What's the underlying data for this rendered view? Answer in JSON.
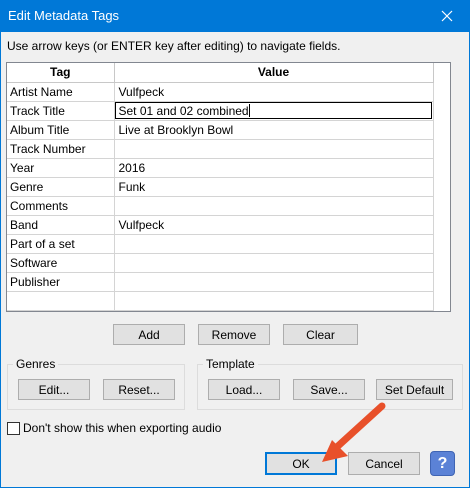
{
  "window": {
    "title": "Edit Metadata Tags",
    "close_glyph": "✕"
  },
  "instructions": "Use arrow keys (or ENTER key after editing) to navigate fields.",
  "table": {
    "headers": [
      "Tag",
      "Value"
    ],
    "rows": [
      {
        "tag": "Artist Name",
        "value": "Vulfpeck"
      },
      {
        "tag": "Track Title",
        "value": "Set 01 and 02 combined"
      },
      {
        "tag": "Album Title",
        "value": "Live at Brooklyn Bowl"
      },
      {
        "tag": "Track Number",
        "value": ""
      },
      {
        "tag": "Year",
        "value": "2016"
      },
      {
        "tag": "Genre",
        "value": "Funk"
      },
      {
        "tag": "Comments",
        "value": ""
      },
      {
        "tag": "Band",
        "value": "Vulfpeck"
      },
      {
        "tag": "Part of a set",
        "value": ""
      },
      {
        "tag": "Software",
        "value": ""
      },
      {
        "tag": "Publisher",
        "value": ""
      },
      {
        "tag": "",
        "value": ""
      }
    ]
  },
  "row_buttons": {
    "add": "Add",
    "remove": "Remove",
    "clear": "Clear"
  },
  "genres": {
    "label": "Genres",
    "edit": "Edit...",
    "reset": "Reset..."
  },
  "template": {
    "label": "Template",
    "load": "Load...",
    "save": "Save...",
    "set_default": "Set Default"
  },
  "checkbox": {
    "label": "Don't show this when exporting audio",
    "checked": false
  },
  "footer": {
    "ok": "OK",
    "cancel": "Cancel",
    "help_glyph": "?"
  },
  "colors": {
    "titlebar": "#0078d7",
    "arrow": "#e8502a",
    "help": "#5b82d6"
  }
}
